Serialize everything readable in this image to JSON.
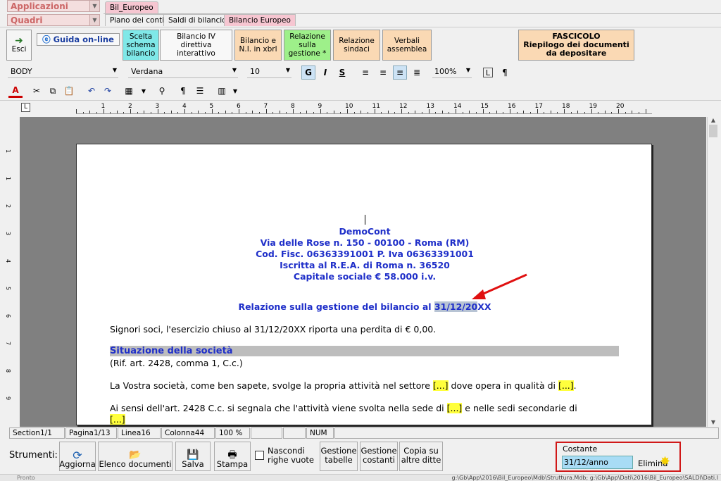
{
  "top": {
    "applicazioni": "Applicazioni",
    "quadri": "Quadri",
    "doc_tab": "Bil_Europeo",
    "tabs": [
      "Piano dei conti",
      "Saldi di bilancio",
      "Bilancio Europeo"
    ]
  },
  "ribbon": {
    "esci": "Esci",
    "guida": "Guida on-line",
    "scelta": [
      "Scelta",
      "schema",
      "bilancio"
    ],
    "bil4": [
      "Bilancio IV direttiva",
      "interattivo"
    ],
    "xbrl": [
      "Bilancio e",
      "N.I. in xbrl"
    ],
    "relazione": [
      "Relazione",
      "sulla",
      "gestione *"
    ],
    "sindaci": [
      "Relazione",
      "sindaci"
    ],
    "verbali": [
      "Verbali",
      "assemblea"
    ],
    "fascicolo": [
      "FASCICOLO",
      "Riepilogo dei documenti",
      "da depositare"
    ]
  },
  "format": {
    "style": "BODY",
    "font": "Verdana",
    "size": "10",
    "bold": "G",
    "italic": "I",
    "strike": "S",
    "zoom": "100%",
    "pilcrow": "¶"
  },
  "ruler": [
    "1",
    "2",
    "3",
    "4",
    "5",
    "6",
    "7",
    "8",
    "9",
    "10",
    "11",
    "12",
    "13",
    "14",
    "15",
    "16",
    "17",
    "18",
    "19",
    "20"
  ],
  "vruler": [
    "1",
    "1",
    "2",
    "3",
    "4",
    "5",
    "6",
    "7",
    "8",
    "9"
  ],
  "doc": {
    "company": "DemoCont",
    "address": "Via delle Rose n. 150 - 00100 - Roma (RM)",
    "fisc": "Cod. Fisc. 06363391001 P. Iva 06363391001",
    "rea": "Iscritta al R.E.A. di Roma n. 36520",
    "capitale": "Capitale sociale € 58.000 i.v.",
    "title_pre": "Relazione sulla gestione del bilancio al ",
    "title_date": "31/12/20",
    "title_post": "XX",
    "p1": "Signori soci, l'esercizio chiuso al 31/12/20XX riporta una perdita di € 0,00.",
    "section": "Situazione della società",
    "rif": "(Rif. art. 2428, comma 1, C.c.)",
    "p2a": "La Vostra società, come ben sapete, svolge la propria attività nel settore ",
    "ph": "[...]",
    "p2b": " dove opera in qualità di ",
    "p2c": ".",
    "p3a": "Ai sensi dell'art. 2428 C.c. si segnala che l'attività viene svolta nella sede di ",
    "p3b": " e nelle sedi secondarie di"
  },
  "status": {
    "section": "Section1/1",
    "page": "Pagina1/13",
    "line": "Linea16",
    "col": "Colonna44",
    "zoom": "100 %",
    "num": "NUM"
  },
  "bottom": {
    "strumenti": "Strumenti:",
    "aggiorna": "Aggiorna",
    "elenco": "Elenco documenti",
    "salva": "Salva",
    "stampa": "Stampa",
    "nascondi": [
      "Nascondi",
      "righe vuote"
    ],
    "tabelle": [
      "Gestione",
      "tabelle"
    ],
    "costanti": [
      "Gestione",
      "costanti"
    ],
    "copia": [
      "Copia su",
      "altre ditte"
    ],
    "costante_label": "Costante",
    "costante_value": "31/12/anno",
    "elimina": "Elimina"
  },
  "footer": {
    "pronto": "Pronto",
    "path": "g:\\Gb\\App\\2016\\Bil_Europeo\\Mdb\\Struttura.Mdb; g:\\Gb\\App\\Dati\\2016\\Bil_Europeo\\SALDI\\Dati.I"
  }
}
